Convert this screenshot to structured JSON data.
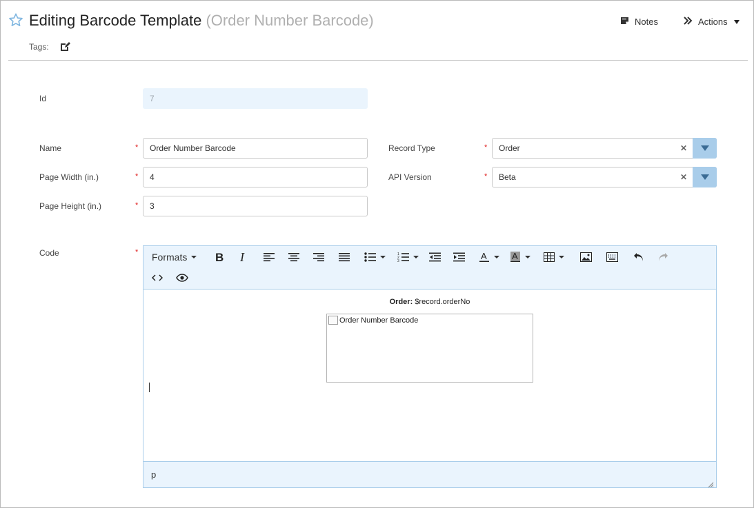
{
  "header": {
    "title": "Editing Barcode Template",
    "subtitle": "(Order Number Barcode)",
    "notes_label": "Notes",
    "actions_label": "Actions",
    "tags_label": "Tags:"
  },
  "form": {
    "id": {
      "label": "Id",
      "value": "7"
    },
    "name": {
      "label": "Name",
      "value": "Order Number Barcode",
      "required": "*"
    },
    "page_width": {
      "label": "Page Width (in.)",
      "value": "4",
      "required": "*"
    },
    "page_height": {
      "label": "Page Height (in.)",
      "value": "3",
      "required": "*"
    },
    "record_type": {
      "label": "Record Type",
      "value": "Order",
      "required": "*"
    },
    "api_version": {
      "label": "API Version",
      "value": "Beta",
      "required": "*"
    },
    "code": {
      "label": "Code",
      "required": "*"
    }
  },
  "editor": {
    "formats_label": "Formats",
    "content": {
      "order_label": "Order:",
      "order_value": "$record.orderNo",
      "image_alt": "Order Number Barcode"
    },
    "status_path": "p"
  },
  "colors": {
    "accent": "#a9cdea",
    "accent_dark": "#3a6b94",
    "panel_bg": "#eaf4fd",
    "required": "#e02020",
    "star": "#7fb6e0"
  }
}
